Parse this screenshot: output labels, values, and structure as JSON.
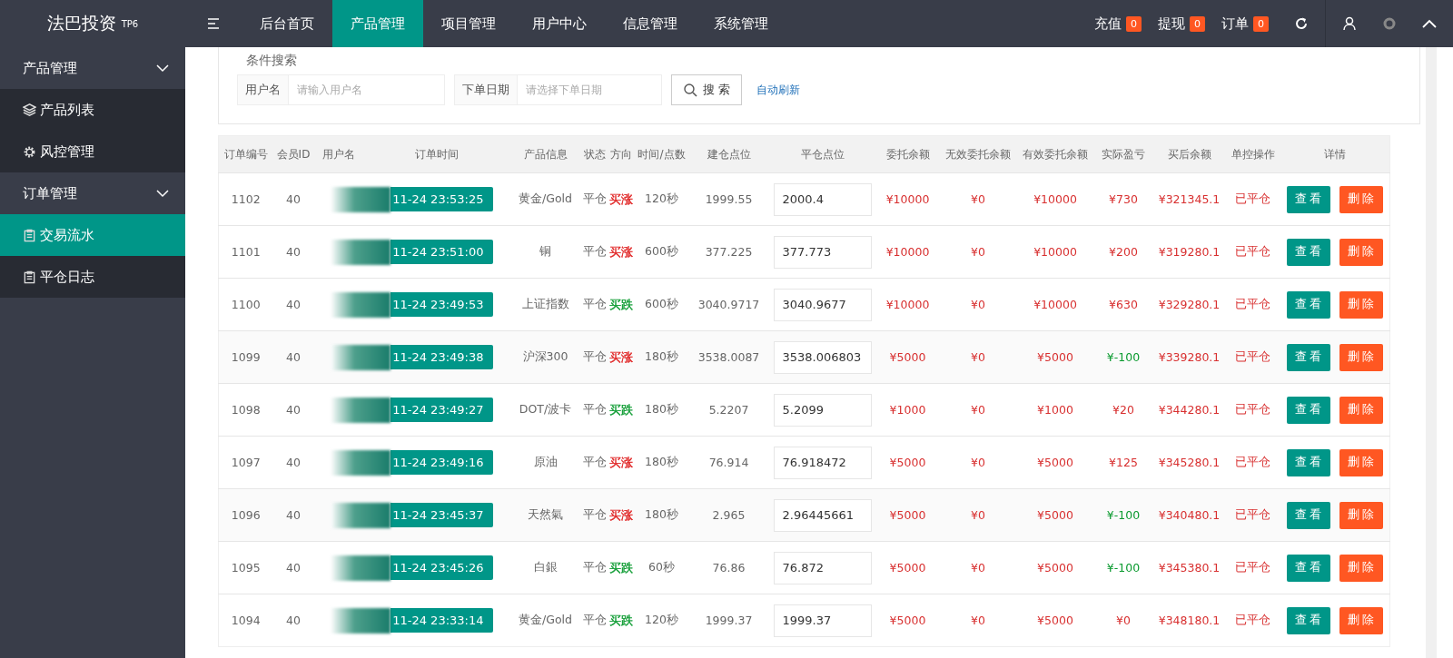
{
  "header": {
    "logo": "法巴投资",
    "logo_badge": "TP6",
    "nav": [
      {
        "label": "后台首页",
        "selected": false
      },
      {
        "label": "产品管理",
        "selected": true
      },
      {
        "label": "项目管理",
        "selected": false
      },
      {
        "label": "用户中心",
        "selected": false
      },
      {
        "label": "信息管理",
        "selected": false
      },
      {
        "label": "系统管理",
        "selected": false
      }
    ],
    "counters": [
      {
        "label": "充值",
        "count": "0"
      },
      {
        "label": "提现",
        "count": "0"
      },
      {
        "label": "订单",
        "count": "0"
      }
    ]
  },
  "sidebar": {
    "groups": [
      {
        "label": "产品管理",
        "expanded": true,
        "children": [
          {
            "label": "产品列表",
            "kind": "layers",
            "selected": false
          },
          {
            "label": "风控管理",
            "kind": "gear",
            "selected": false
          }
        ]
      },
      {
        "label": "订单管理",
        "expanded": true,
        "children": [
          {
            "label": "交易流水",
            "kind": "clipboard",
            "selected": true
          },
          {
            "label": "平仓日志",
            "kind": "clipboard",
            "selected": false
          }
        ]
      }
    ]
  },
  "search": {
    "legend": "条件搜索",
    "fields": [
      {
        "label": "用户名",
        "placeholder": "请输入用户名"
      },
      {
        "label": "下单日期",
        "placeholder": "请选择下单日期"
      }
    ],
    "button": "搜 索",
    "link": "自动刷新"
  },
  "table": {
    "columns": [
      "订单编号",
      "会员ID",
      "用户名",
      "订单时间",
      "产品信息",
      "状态",
      "方向",
      "时间/点数",
      "建仓点位",
      "平仓点位",
      "委托余额",
      "无效委托余额",
      "有效委托余额",
      "实际盈亏",
      "买后余额",
      "单控操作",
      "详情"
    ],
    "rows": [
      {
        "id": "1102",
        "member_id": "40",
        "time": "11-24 23:53:25",
        "product": "黄金/Gold",
        "status": "平仓",
        "direction": {
          "text": "买涨",
          "color": "#e02222"
        },
        "duration": "120秒",
        "open_price": "1999.55",
        "close_price": "2000.4",
        "amount": "¥10000",
        "invalid": "¥0",
        "valid": "¥10000",
        "profit": {
          "text": "¥730",
          "color": "#d83030"
        },
        "balance": "¥321345.1",
        "control": "已平仓",
        "view": "查看",
        "delete": "删除"
      },
      {
        "id": "1101",
        "member_id": "40",
        "time": "11-24 23:51:00",
        "product": "铜",
        "status": "平仓",
        "direction": {
          "text": "买涨",
          "color": "#e02222"
        },
        "duration": "600秒",
        "open_price": "377.225",
        "close_price": "377.773",
        "amount": "¥10000",
        "invalid": "¥0",
        "valid": "¥10000",
        "profit": {
          "text": "¥200",
          "color": "#d83030"
        },
        "balance": "¥319280.1",
        "control": "已平仓",
        "view": "查看",
        "delete": "删除"
      },
      {
        "id": "1100",
        "member_id": "40",
        "time": "11-24 23:49:53",
        "product": "上证指数",
        "status": "平仓",
        "direction": {
          "text": "买跌",
          "color": "#0a9a2f"
        },
        "duration": "600秒",
        "open_price": "3040.9717",
        "close_price": "3040.9677",
        "amount": "¥10000",
        "invalid": "¥0",
        "valid": "¥10000",
        "profit": {
          "text": "¥630",
          "color": "#d83030"
        },
        "balance": "¥329280.1",
        "control": "已平仓",
        "view": "查看",
        "delete": "删除"
      },
      {
        "id": "1099",
        "member_id": "40",
        "time": "11-24 23:49:38",
        "product": "沪深300",
        "status": "平仓",
        "direction": {
          "text": "买涨",
          "color": "#e02222"
        },
        "duration": "180秒",
        "open_price": "3538.0087",
        "close_price": "3538.006803",
        "amount": "¥5000",
        "invalid": "¥0",
        "valid": "¥5000",
        "profit": {
          "text": "¥-100",
          "color": "#0a9a2f"
        },
        "balance": "¥339280.1",
        "control": "已平仓",
        "view": "查看",
        "delete": "删除"
      },
      {
        "id": "1098",
        "member_id": "40",
        "time": "11-24 23:49:27",
        "product": "DOT/波卡",
        "status": "平仓",
        "direction": {
          "text": "买跌",
          "color": "#0a9a2f"
        },
        "duration": "180秒",
        "open_price": "5.2207",
        "close_price": "5.2099",
        "amount": "¥1000",
        "invalid": "¥0",
        "valid": "¥1000",
        "profit": {
          "text": "¥20",
          "color": "#d83030"
        },
        "balance": "¥344280.1",
        "control": "已平仓",
        "view": "查看",
        "delete": "删除"
      },
      {
        "id": "1097",
        "member_id": "40",
        "time": "11-24 23:49:16",
        "product": "原油",
        "status": "平仓",
        "direction": {
          "text": "买涨",
          "color": "#e02222"
        },
        "duration": "180秒",
        "open_price": "76.914",
        "close_price": "76.918472",
        "amount": "¥5000",
        "invalid": "¥0",
        "valid": "¥5000",
        "profit": {
          "text": "¥125",
          "color": "#d83030"
        },
        "balance": "¥345280.1",
        "control": "已平仓",
        "view": "查看",
        "delete": "删除"
      },
      {
        "id": "1096",
        "member_id": "40",
        "time": "11-24 23:45:37",
        "product": "天然氣",
        "status": "平仓",
        "direction": {
          "text": "买涨",
          "color": "#e02222"
        },
        "duration": "180秒",
        "open_price": "2.965",
        "close_price": "2.96445661",
        "amount": "¥5000",
        "invalid": "¥0",
        "valid": "¥5000",
        "profit": {
          "text": "¥-100",
          "color": "#0a9a2f"
        },
        "balance": "¥340480.1",
        "control": "已平仓",
        "view": "查看",
        "delete": "删除"
      },
      {
        "id": "1095",
        "member_id": "40",
        "time": "11-24 23:45:26",
        "product": "白銀",
        "status": "平仓",
        "direction": {
          "text": "买跌",
          "color": "#0a9a2f"
        },
        "duration": "60秒",
        "open_price": "76.86",
        "close_price": "76.872",
        "amount": "¥5000",
        "invalid": "¥0",
        "valid": "¥5000",
        "profit": {
          "text": "¥-100",
          "color": "#0a9a2f"
        },
        "balance": "¥345380.1",
        "control": "已平仓",
        "view": "查看",
        "delete": "删除"
      },
      {
        "id": "1094",
        "member_id": "40",
        "time": "11-24 23:33:14",
        "product": "黄金/Gold",
        "status": "平仓",
        "direction": {
          "text": "买跌",
          "color": "#0a9a2f"
        },
        "duration": "120秒",
        "open_price": "1999.37",
        "close_price": "1999.37",
        "amount": "¥5000",
        "invalid": "¥0",
        "valid": "¥5000",
        "profit": {
          "text": "¥0",
          "color": "#d83030"
        },
        "balance": "¥348180.1",
        "control": "已平仓",
        "view": "查看",
        "delete": "删除"
      }
    ]
  }
}
